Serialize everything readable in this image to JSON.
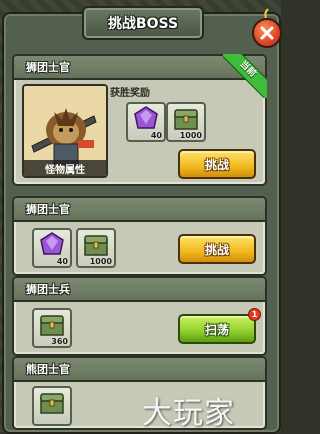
{
  "window": {
    "title": "挑战BOSS"
  },
  "icons": {
    "close": "close-icon",
    "gem": "purple-gem-icon",
    "chest": "treasure-chest-icon"
  },
  "colors": {
    "frame": "#53604f",
    "accent_yellow": "#f2b91f",
    "accent_green": "#8fcf2a",
    "current_ribbon": "#3fbd3a"
  },
  "featured": {
    "name": "狮团士官",
    "badge": "当前",
    "attr_label": "怪物属性",
    "reward_label": "获胜奖励",
    "rewards": [
      {
        "icon": "purple-gem-icon",
        "qty": "40"
      },
      {
        "icon": "treasure-chest-icon",
        "qty": "1000"
      }
    ],
    "action": "挑战"
  },
  "list": [
    {
      "name": "狮团士官",
      "rewards": [
        {
          "icon": "purple-gem-icon",
          "qty": "40"
        },
        {
          "icon": "treasure-chest-icon",
          "qty": "1000"
        }
      ],
      "action": "挑战"
    },
    {
      "name": "狮团士兵",
      "rewards": [
        {
          "icon": "treasure-chest-icon",
          "qty": "360"
        }
      ],
      "action": "扫荡",
      "notification": "1"
    },
    {
      "name": "熊团士官",
      "rewards": [],
      "action": ""
    }
  ],
  "watermark": "大玩家"
}
